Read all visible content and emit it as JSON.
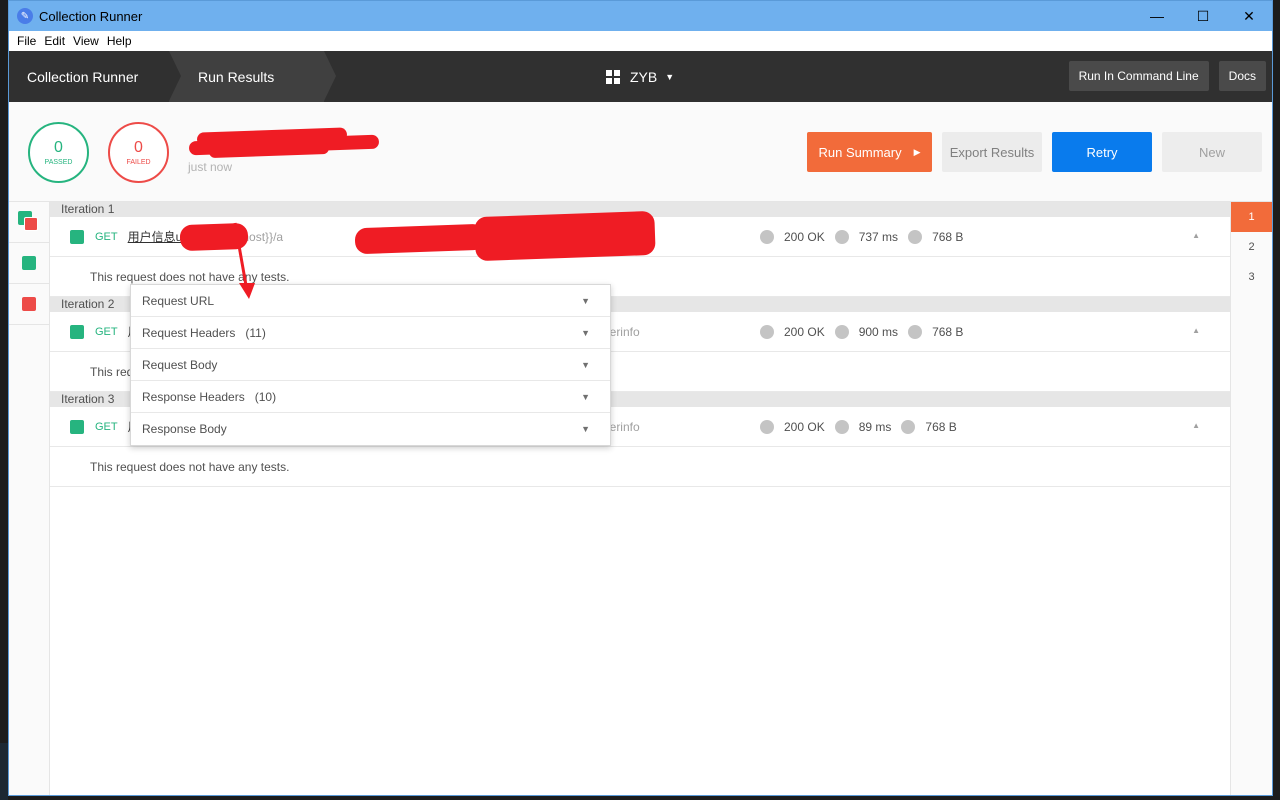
{
  "window": {
    "title": "Collection Runner",
    "minimize": "—",
    "maximize": "☐",
    "close": "✕"
  },
  "menu": [
    "File",
    "Edit",
    "View",
    "Help"
  ],
  "topbar": {
    "crumb1": "Collection Runner",
    "crumb2": "Run Results",
    "workspace": "ZYB",
    "run_cli_label": "Run In Command Line",
    "docs_label": "Docs"
  },
  "summary": {
    "passed_count": "0",
    "passed_label": "PASSED",
    "failed_count": "0",
    "failed_label": "FAILED",
    "run_time": "just now",
    "run_summary_label": "Run Summary",
    "export_label": "Export Results",
    "retry_label": "Retry",
    "new_label": "New"
  },
  "iterations": [
    {
      "title": "Iteration 1",
      "method": "GET",
      "name": "用户信息us",
      "url": "{{http}}{{host}}/a",
      "status": "200 OK",
      "time": "737 ms",
      "size": "768 B",
      "tests": "This request does not have any tests."
    },
    {
      "title": "Iteration 2",
      "method": "GET",
      "name": "用",
      "url": "erinfo",
      "status": "200 OK",
      "time": "900 ms",
      "size": "768 B",
      "tests": "This req"
    },
    {
      "title": "Iteration 3",
      "method": "GET",
      "name": "用",
      "url": "erinfo",
      "status": "200 OK",
      "time": "89 ms",
      "size": "768 B",
      "tests": "This request does not have any tests."
    }
  ],
  "dropdown": [
    {
      "label": "Request URL",
      "count": ""
    },
    {
      "label": "Request Headers",
      "count": "(11)"
    },
    {
      "label": "Request Body",
      "count": ""
    },
    {
      "label": "Response Headers",
      "count": "(10)"
    },
    {
      "label": "Response Body",
      "count": ""
    }
  ],
  "pages": [
    "1",
    "2",
    "3"
  ],
  "colors": {
    "passed": "#26b47f",
    "failed": "#ed4b48",
    "accent": "#f26b3a",
    "primary": "#097bed"
  }
}
